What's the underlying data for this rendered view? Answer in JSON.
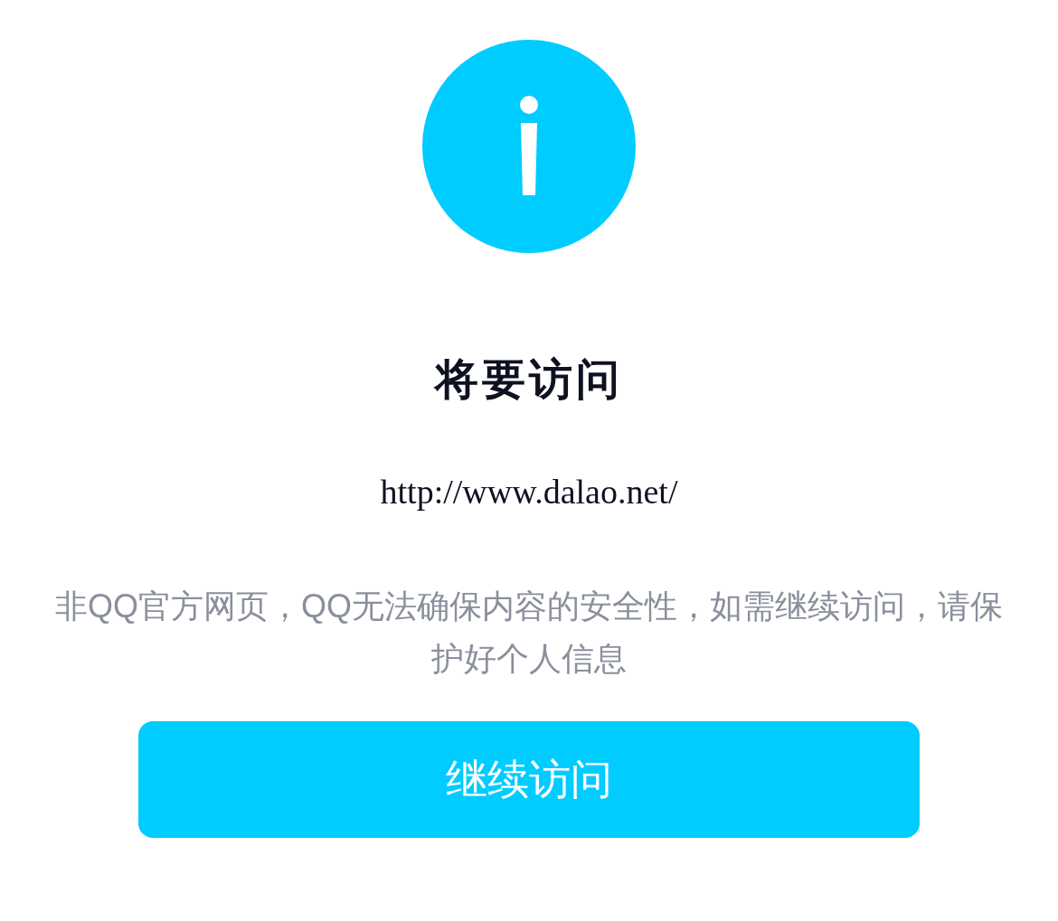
{
  "title": "将要访问",
  "url": "http://www.dalao.net/",
  "warning": "非QQ官方网页，QQ无法确保内容的安全性，如需继续访问，请保护好个人信息",
  "button": "继续访问"
}
